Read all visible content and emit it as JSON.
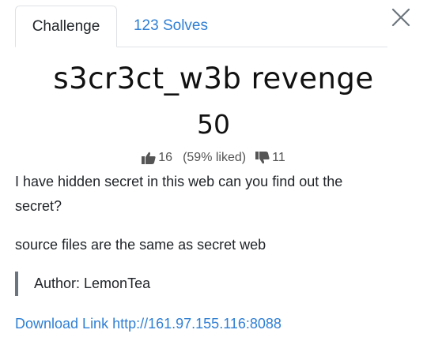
{
  "tabs": [
    {
      "label": "Challenge",
      "active": true
    },
    {
      "label": "123 Solves",
      "active": false
    }
  ],
  "close_icon": "close-icon",
  "challenge": {
    "title": "s3cr3ct_w3b revenge",
    "points": "50",
    "likes": "16",
    "liked_percent": "(59% liked)",
    "dislikes": "11",
    "description_lines": [
      "I have hidden secret in this web can you find out the secret?",
      "source files are the same as secret web"
    ],
    "author": "Author: LemonTea",
    "download_link": "Download Link http://161.97.155.116:8088"
  },
  "colors": {
    "link": "#2f7fd4",
    "text": "#212529",
    "muted": "#555555",
    "border": "#dee2e6"
  }
}
